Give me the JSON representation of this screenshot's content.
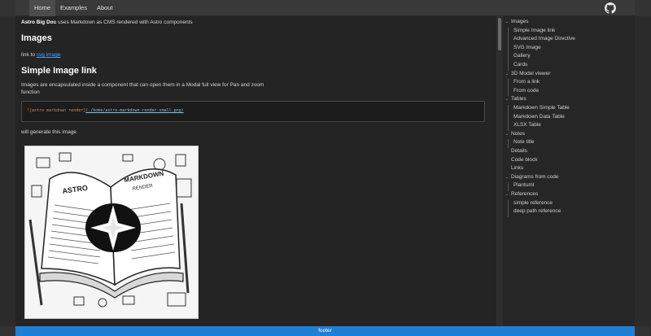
{
  "nav": {
    "items": [
      {
        "label": "Home",
        "active": true
      },
      {
        "label": "Examples",
        "active": false
      },
      {
        "label": "About",
        "active": false
      }
    ],
    "github_icon": "github-icon"
  },
  "content": {
    "intro_bold": "Astro Big Doc",
    "intro_rest": " uses Markdown as CMS rendered with Astro components",
    "section_heading": "Images",
    "link_prefix": "link to ",
    "link_text": "svg image",
    "subheading": "Simple Image link",
    "paragraph": "Images are encapsulated inside a component that can open them in a Modal full view for Pan and zoom function",
    "code_alt": "![astro markdown render]",
    "code_path": "(./home/astro-markdown-render-small.png)",
    "will_text": "will generate this image",
    "image_label_1": "ASTRO",
    "image_label_2": "MARKDOWN",
    "image_label_3": "RENDER"
  },
  "toc": {
    "items": [
      {
        "label": "Images",
        "level": 0,
        "caret": true
      },
      {
        "label": "Simple Image link",
        "level": 1
      },
      {
        "label": "Advanced Image Directive",
        "level": 1
      },
      {
        "label": "SVG Image",
        "level": 1
      },
      {
        "label": "Gallery",
        "level": 1
      },
      {
        "label": "Cards",
        "level": 1
      },
      {
        "label": "3D Model viewer",
        "level": 0,
        "caret": true
      },
      {
        "label": "From a link",
        "level": 1
      },
      {
        "label": "From code",
        "level": 1
      },
      {
        "label": "Tables",
        "level": 0,
        "caret": true
      },
      {
        "label": "Markdown Simple Table",
        "level": 1
      },
      {
        "label": "Markdown Data Table",
        "level": 1
      },
      {
        "label": "XLSX Table",
        "level": 1
      },
      {
        "label": "Notes",
        "level": 0,
        "caret": true
      },
      {
        "label": "Note title",
        "level": 1
      },
      {
        "label": "Details",
        "level": 0,
        "caret": false
      },
      {
        "label": "Code block",
        "level": 0,
        "caret": false
      },
      {
        "label": "Links",
        "level": 0,
        "caret": false
      },
      {
        "label": "Diagrams from code",
        "level": 0,
        "caret": true
      },
      {
        "label": "Plantuml",
        "level": 1
      },
      {
        "label": "References",
        "level": 0,
        "caret": true
      },
      {
        "label": "simple reference",
        "level": 1
      },
      {
        "label": "deep path reference",
        "level": 1
      }
    ]
  },
  "footer": {
    "label": "footer"
  },
  "colors": {
    "footer_bg": "#1e7fd6",
    "link": "#4ea0ff"
  }
}
